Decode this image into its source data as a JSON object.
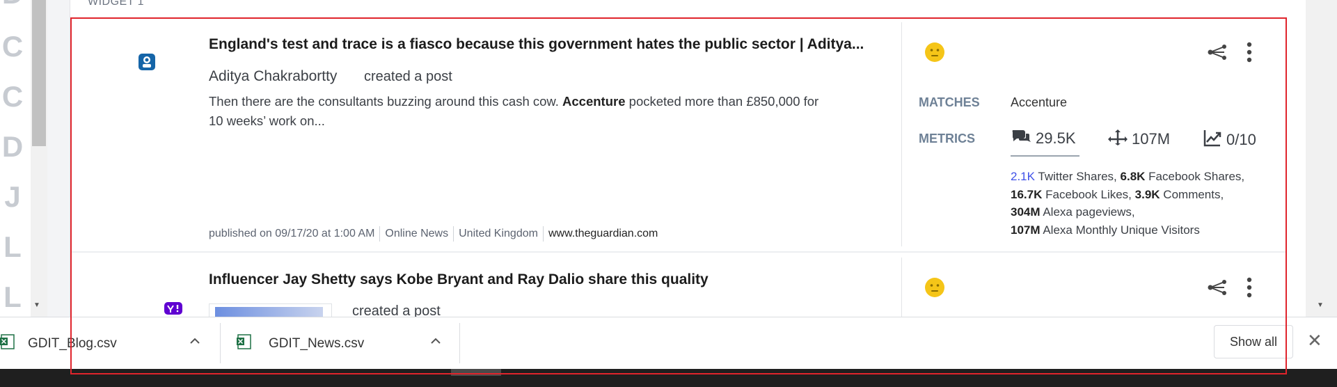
{
  "rail": {
    "letters": [
      "D",
      "C",
      "C",
      "D",
      "J",
      "L",
      "L"
    ]
  },
  "widget": {
    "label": "WIDGET 1"
  },
  "post1": {
    "title": "England's test and trace is a fiasco because this government hates the public sector | Aditya...",
    "author": "Aditya Chakrabortty",
    "action": "created a post",
    "snippet_pre": "Then there are the consultants buzzing around this cash cow.",
    "snippet_bold": "Accenture",
    "snippet_post": "pocketed more than £850,000 for",
    "snippet_line2": "10 weeks’ work on...",
    "published": "published on 09/17/20 at 1:00 AM",
    "source_type": "Online News",
    "country": "United Kingdom",
    "url": "www.theguardian.com",
    "matches_label": "MATCHES",
    "matches_value": "Accenture",
    "metrics_label": "METRICS",
    "metric_comments": "29.5K",
    "metric_reach": "107M",
    "metric_score": "0/10",
    "detail": {
      "twitter_val": "2.1K",
      "twitter_lbl": "Twitter Shares,",
      "fbshare_val": "6.8K",
      "fbshare_lbl": "Facebook Shares,",
      "fblike_val": "16.7K",
      "fblike_lbl": "Facebook Likes,",
      "comments_val": "3.9K",
      "comments_lbl": "Comments,",
      "alexa_pv_val": "304M",
      "alexa_pv_lbl": "Alexa pageviews,",
      "alexa_uv_val": "107M",
      "alexa_uv_lbl": "Alexa Monthly Unique Visitors"
    }
  },
  "post2": {
    "title": "Influencer Jay Shetty says Kobe Bryant and Ray Dalio share this quality",
    "action": "created a post"
  },
  "downloads": {
    "file1": "GDIT_Blog.csv",
    "file2": "GDIT_News.csv",
    "show_all": "Show all"
  },
  "colors": {
    "sentiment": "#f5c518",
    "highlight_border": "#e0242c",
    "link_blue": "#3f51e8"
  }
}
